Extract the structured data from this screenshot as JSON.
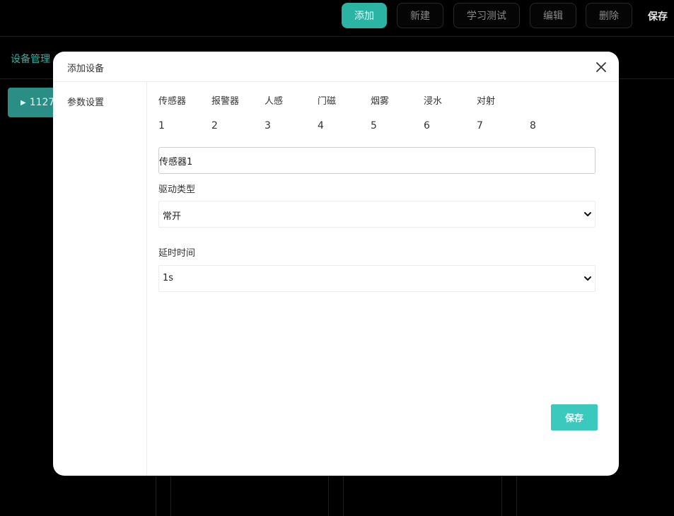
{
  "toolbar": {
    "buttons": [
      {
        "label": "添加",
        "primary": true
      },
      {
        "label": "新建",
        "primary": false
      },
      {
        "label": "学习测试",
        "primary": false
      },
      {
        "label": "编辑",
        "primary": false
      },
      {
        "label": "删除",
        "primary": false
      }
    ],
    "save_label": "保存"
  },
  "background": {
    "nav_label": "设备管理",
    "device_label": "1127"
  },
  "modal": {
    "title": "添加设备",
    "sidebar_item": "参数设置",
    "tabs": [
      "传感器",
      "报警器",
      "人感",
      "门磁",
      "烟雾",
      "浸水",
      "对射"
    ],
    "numbers": [
      "1",
      "2",
      "3",
      "4",
      "5",
      "6",
      "7",
      "8"
    ],
    "name_input_value": "传感器1",
    "drive_type": {
      "label": "驱动类型",
      "selected": "常开"
    },
    "delay_time": {
      "label": "延时时间",
      "selected": "1s"
    },
    "save_label": "保存"
  },
  "colors": {
    "accent": "#2bb3a3",
    "save_button": "#3cc9bd"
  }
}
